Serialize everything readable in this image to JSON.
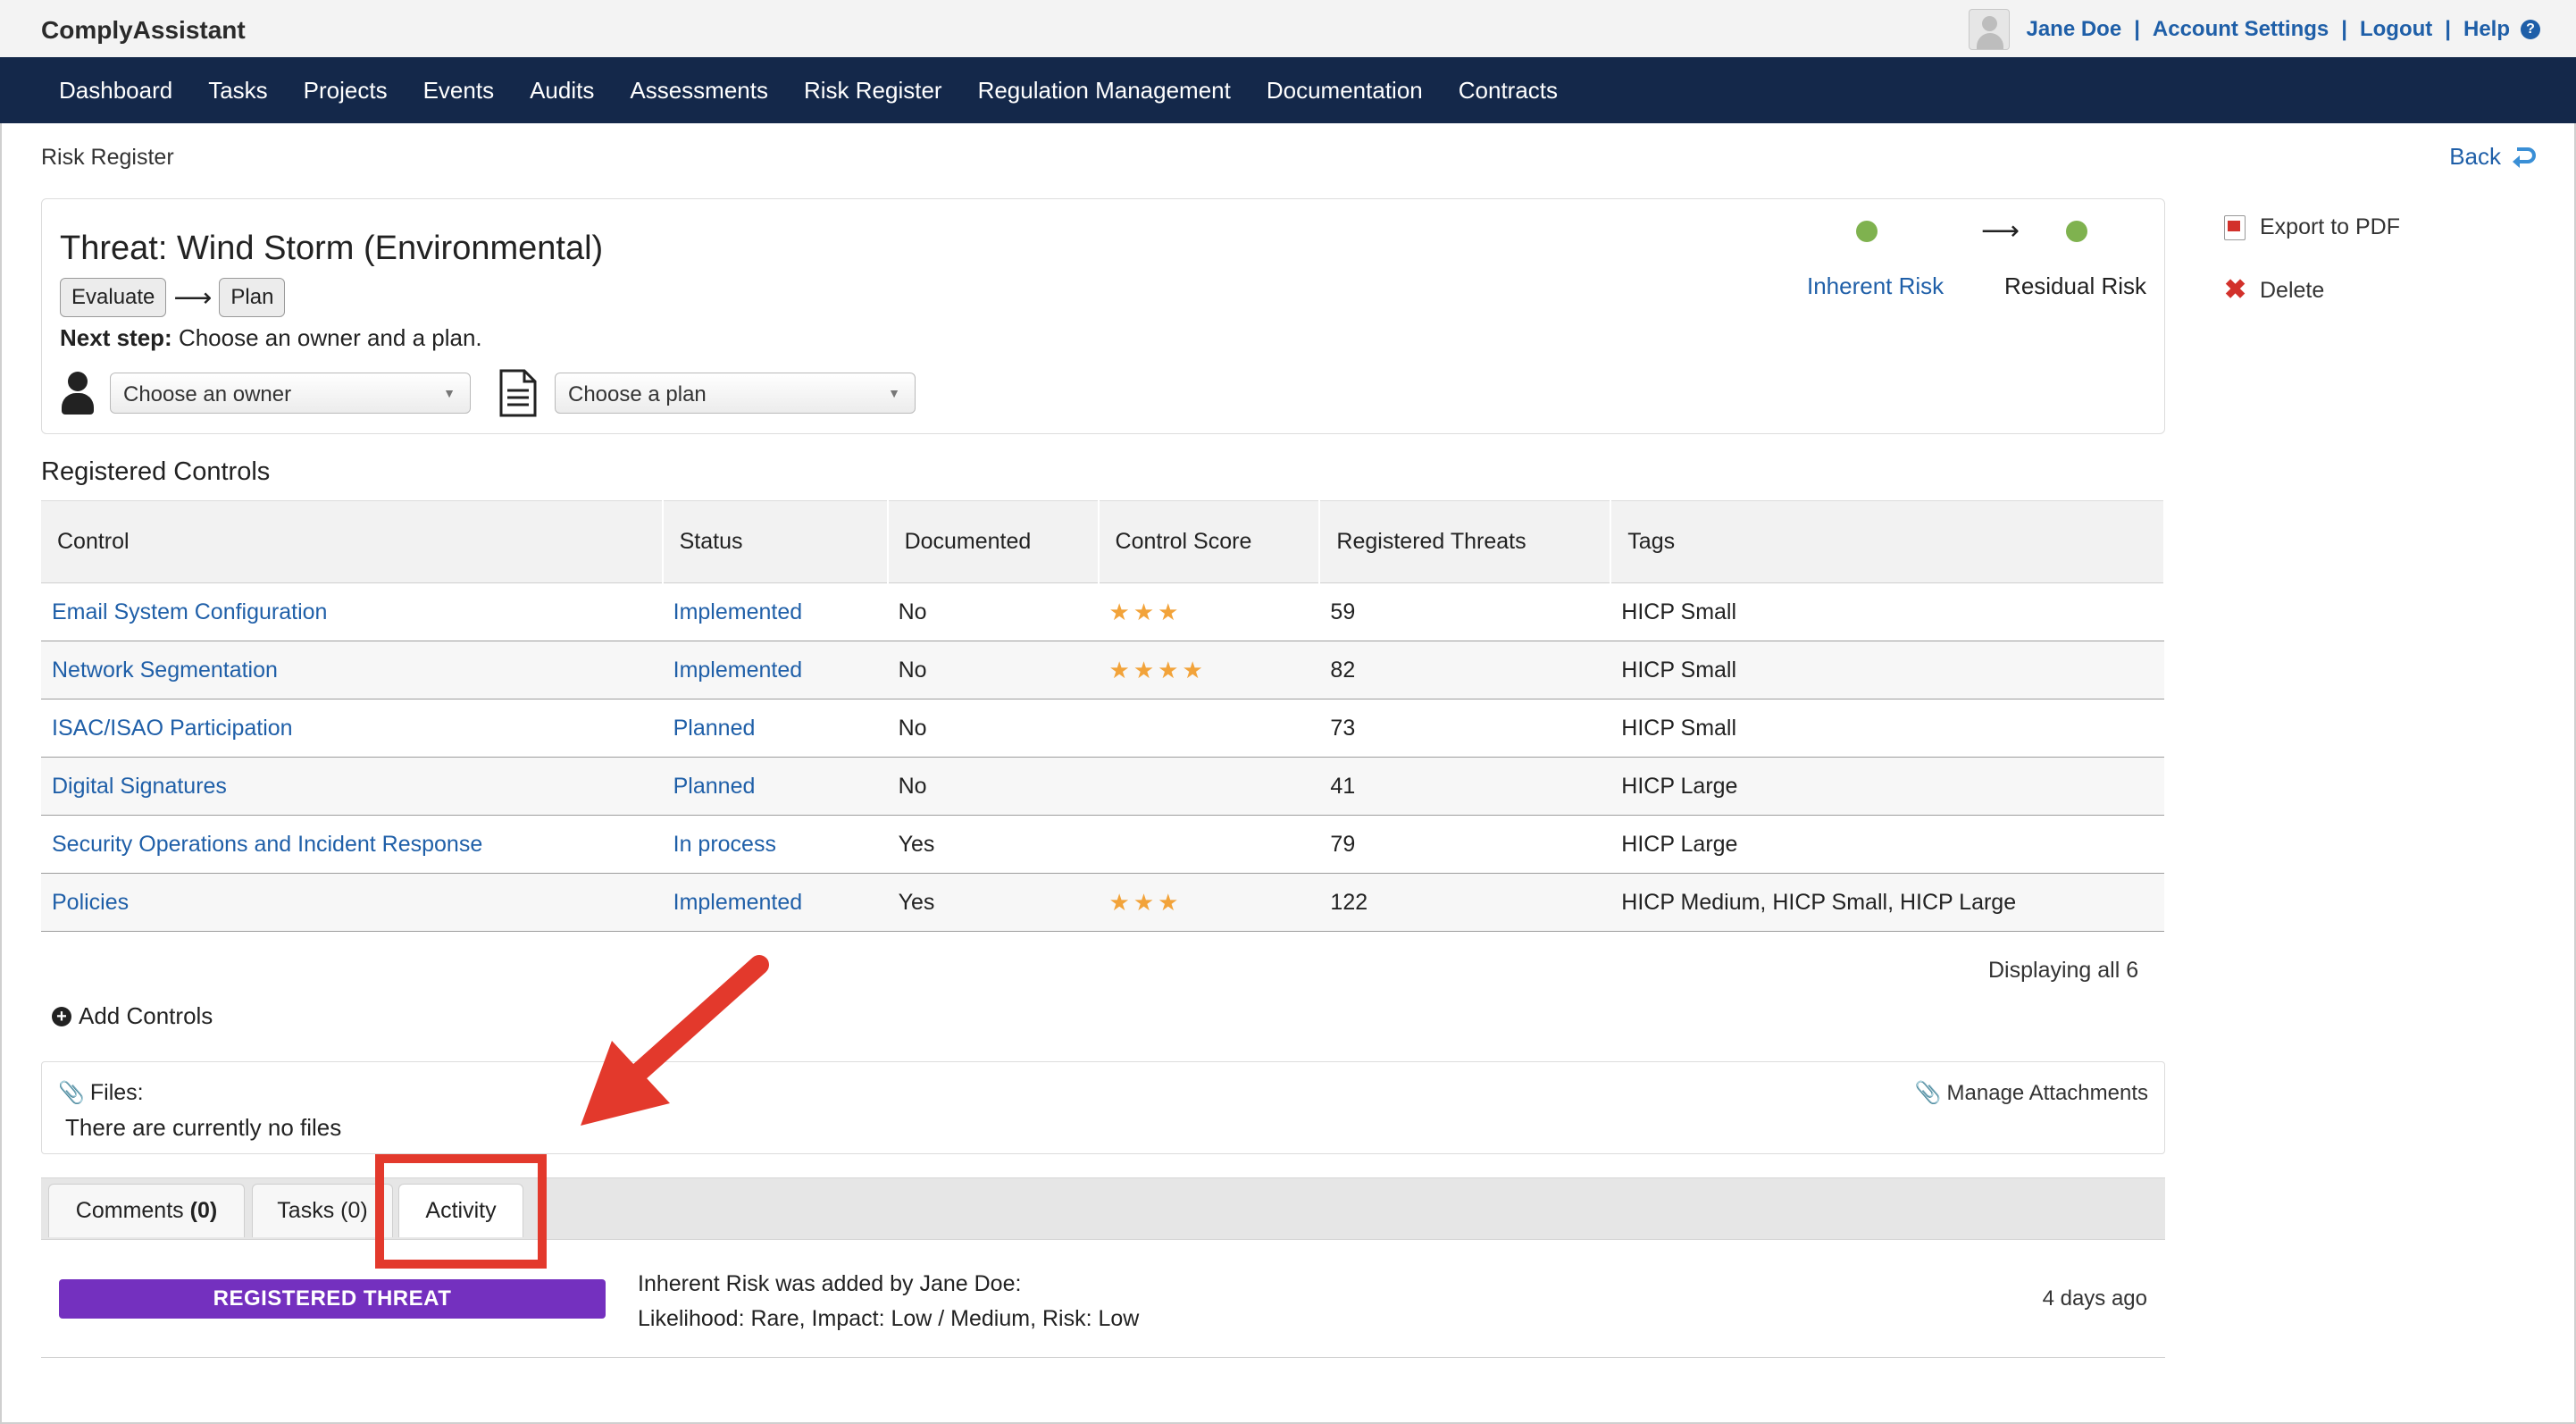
{
  "app": {
    "title": "ComplyAssistant"
  },
  "header": {
    "user_name": "Jane Doe",
    "account_settings": "Account Settings",
    "logout": "Logout",
    "help": "Help"
  },
  "nav": [
    "Dashboard",
    "Tasks",
    "Projects",
    "Events",
    "Audits",
    "Assessments",
    "Risk Register",
    "Regulation Management",
    "Documentation",
    "Contracts"
  ],
  "breadcrumb": "Risk Register",
  "back_label": "Back",
  "threat": {
    "title": "Threat: Wind Storm (Environmental)",
    "step_evaluate": "Evaluate",
    "step_plan": "Plan",
    "next_step_label": "Next step:",
    "next_step_text": "Choose an owner and a plan.",
    "owner_placeholder": "Choose an owner",
    "plan_placeholder": "Choose a plan",
    "inherent_risk_label": "Inherent Risk",
    "residual_risk_label": "Residual Risk",
    "risk_dot_color": "#7fb24f"
  },
  "side_actions": {
    "export_pdf": "Export to PDF",
    "delete": "Delete"
  },
  "controls": {
    "section_title": "Registered Controls",
    "columns": [
      "Control",
      "Status",
      "Documented",
      "Control Score",
      "Registered Threats",
      "Tags"
    ],
    "rows": [
      {
        "control": "Email System Configuration",
        "status": "Implemented",
        "documented": "No",
        "score": 3,
        "threats": "59",
        "tags": "HICP Small"
      },
      {
        "control": "Network Segmentation",
        "status": "Implemented",
        "documented": "No",
        "score": 4,
        "threats": "82",
        "tags": "HICP Small"
      },
      {
        "control": "ISAC/ISAO Participation",
        "status": "Planned",
        "documented": "No",
        "score": 0,
        "threats": "73",
        "tags": "HICP Small"
      },
      {
        "control": "Digital Signatures",
        "status": "Planned",
        "documented": "No",
        "score": 0,
        "threats": "41",
        "tags": "HICP Large"
      },
      {
        "control": "Security Operations and Incident Response",
        "status": "In process",
        "documented": "Yes",
        "score": 0,
        "threats": "79",
        "tags": "HICP Large"
      },
      {
        "control": "Policies",
        "status": "Implemented",
        "documented": "Yes",
        "score": 3,
        "threats": "122",
        "tags": "HICP Medium, HICP Small, HICP Large"
      }
    ],
    "displaying": "Displaying all 6",
    "add_controls": "Add Controls"
  },
  "files": {
    "label": "Files:",
    "empty_text": "There are currently no files",
    "manage": "Manage Attachments"
  },
  "tabs": {
    "comments_label": "Comments",
    "comments_count": "(0)",
    "tasks_label": "Tasks (0)",
    "activity_label": "Activity",
    "active": "Activity"
  },
  "activity": {
    "badge": "REGISTERED THREAT",
    "badge_color": "#7430bf",
    "line1": "Inherent Risk was added by Jane Doe:",
    "line2": "Likelihood: Rare, Impact: Low / Medium, Risk: Low",
    "time": "4 days ago"
  },
  "annotation_color": "#e3392c"
}
